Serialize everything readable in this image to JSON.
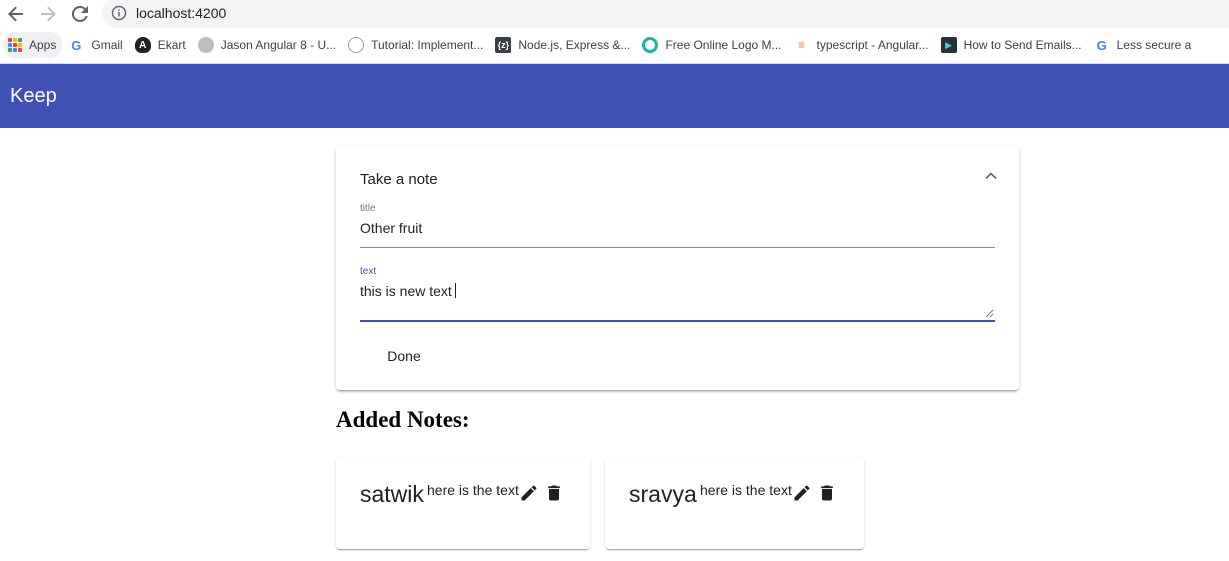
{
  "browser": {
    "url": "localhost:4200",
    "bookmarks": [
      {
        "label": "Apps",
        "icon": "apps-grid-icon"
      },
      {
        "label": "Gmail",
        "icon": "google-icon"
      },
      {
        "label": "Ekart",
        "icon": "angular-icon"
      },
      {
        "label": "Jason Angular 8 - U...",
        "icon": "avatar-icon"
      },
      {
        "label": "Tutorial: Implement...",
        "icon": "globe-icon"
      },
      {
        "label": "Node.js, Express &...",
        "icon": "zeal-icon"
      },
      {
        "label": "Free Online Logo M...",
        "icon": "logo-maker-icon"
      },
      {
        "label": "typescript - Angular...",
        "icon": "stackoverflow-icon"
      },
      {
        "label": "How to Send Emails...",
        "icon": "video-icon"
      },
      {
        "label": "Less secure a",
        "icon": "google-icon"
      }
    ]
  },
  "toolbar": {
    "title": "Keep",
    "color": "#3f51b5"
  },
  "panel": {
    "header": "Take a note",
    "title_label": "title",
    "title_value": "Other fruit",
    "text_label": "text",
    "text_value": "this is new text",
    "done_label": "Done"
  },
  "notes": {
    "heading": "Added Notes:",
    "items": [
      {
        "title": "satwik",
        "text": "here is the text"
      },
      {
        "title": "sravya",
        "text": "here is the text"
      }
    ]
  }
}
